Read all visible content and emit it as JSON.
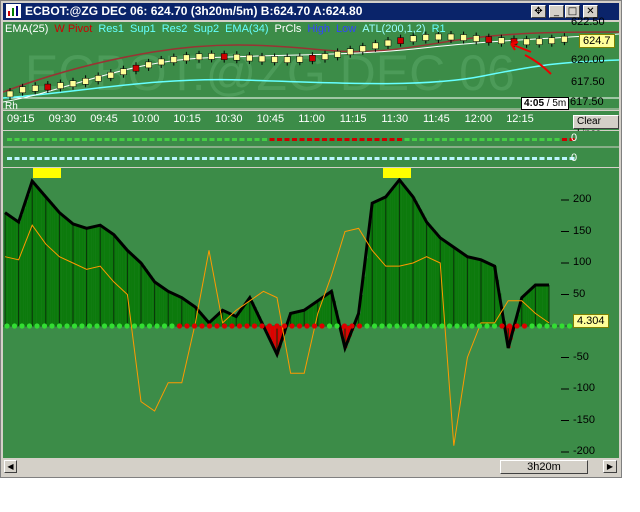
{
  "window": {
    "title": "ECBOT:@ZG DEC 06: 624.70 (3h20m/5m)  B:624.70  A:624.80",
    "controls": [
      "move",
      "minimize",
      "maximize",
      "close"
    ]
  },
  "price_panel": {
    "watermark": "ECBOT:@ZG DEC 06",
    "indicators": [
      {
        "label": "EMA(25)",
        "color": "#ffffff"
      },
      {
        "label": "W Pivot",
        "color": "#cc0000"
      },
      {
        "label": "Res1",
        "color": "#66ffff"
      },
      {
        "label": "Sup1",
        "color": "#66ffff"
      },
      {
        "label": "Res2",
        "color": "#66ffff"
      },
      {
        "label": "Sup2",
        "color": "#66ffff"
      },
      {
        "label": "EMA(34)",
        "color": "#66ffff"
      },
      {
        "label": "PrCls",
        "color": "#ffffff"
      },
      {
        "label": "High",
        "color": "#3344ff"
      },
      {
        "label": "Low",
        "color": "#3344ff"
      },
      {
        "label": "ATL(200,1,2)",
        "color": "#99ffff"
      },
      {
        "label": "R1",
        "color": "#66ffff"
      }
    ],
    "rh_marker": "Rh",
    "current_price": "624.7",
    "y_ticks": [
      "620.00",
      "617.50"
    ],
    "y_tick_partial": "622.50",
    "time_remaining": "4:05",
    "bar_interval": "/ 5m",
    "clear_lines_label": "Clear Lines",
    "colors": {
      "bg": "#3c8c48",
      "candle_up": "#ffff99",
      "candle_down": "#cc0000",
      "annotation": "#ee0000"
    }
  },
  "time_axis": {
    "labels": [
      "09:15",
      "09:30",
      "09:45",
      "10:00",
      "10:15",
      "10:30",
      "10:45",
      "11:00",
      "11:15",
      "11:30",
      "11:45",
      "12:00",
      "12:15"
    ]
  },
  "dot_panels": [
    {
      "value": "0"
    },
    {
      "value": "0"
    }
  ],
  "osc_panel": {
    "y_ticks": [
      "200",
      "150",
      "100",
      "50",
      "-50",
      "-100",
      "-150",
      "-200"
    ],
    "current_value": "4.304"
  },
  "chart_data": {
    "type": "area",
    "x": [
      "09:05",
      "09:10",
      "09:15",
      "09:20",
      "09:25",
      "09:30",
      "09:35",
      "09:40",
      "09:45",
      "09:50",
      "09:55",
      "10:00",
      "10:05",
      "10:10",
      "10:15",
      "10:20",
      "10:25",
      "10:30",
      "10:35",
      "10:40",
      "10:45",
      "10:50",
      "10:55",
      "11:00",
      "11:05",
      "11:10",
      "11:15",
      "11:20",
      "11:25",
      "11:30",
      "11:35",
      "11:40",
      "11:45",
      "11:50",
      "11:55",
      "12:00",
      "12:05",
      "12:10",
      "12:15",
      "12:20",
      "12:25"
    ],
    "series": [
      {
        "values": [
          180,
          165,
          230,
          205,
          180,
          162,
          155,
          160,
          145,
          120,
          100,
          70,
          55,
          45,
          30,
          5,
          25,
          15,
          45,
          0,
          -45,
          20,
          25,
          40,
          55,
          -35,
          20,
          195,
          205,
          232,
          205,
          165,
          140,
          125,
          110,
          105,
          95,
          -35,
          45,
          65,
          65
        ]
      },
      {
        "values": [
          110,
          105,
          160,
          130,
          110,
          100,
          90,
          95,
          70,
          50,
          -120,
          -135,
          -90,
          -90,
          5,
          120,
          5,
          25,
          40,
          55,
          45,
          -75,
          -75,
          20,
          80,
          150,
          155,
          120,
          95,
          95,
          100,
          110,
          100,
          -190,
          -50,
          5,
          5,
          40,
          40,
          20,
          5
        ]
      }
    ],
    "ylim": [
      -200,
      225
    ]
  },
  "scrollbar": {
    "label": "3h20m"
  }
}
